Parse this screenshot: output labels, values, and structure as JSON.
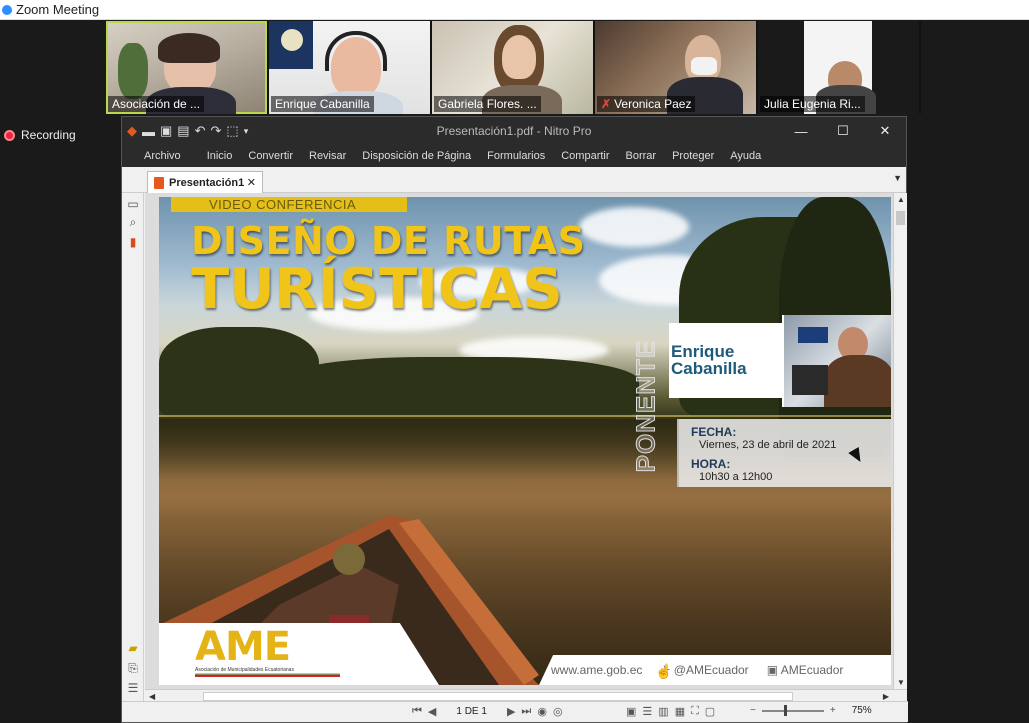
{
  "zoom": {
    "window_title": "Zoom Meeting",
    "recording_label": "Recording",
    "participants": [
      {
        "name": "Asociación de ...",
        "muted": false,
        "active": true
      },
      {
        "name": "Enrique Cabanilla",
        "muted": false,
        "active": false
      },
      {
        "name": "Gabriela Flores. ...",
        "muted": false,
        "active": false
      },
      {
        "name": "Veronica Paez",
        "muted": true,
        "active": false
      },
      {
        "name": "Julia Eugenia Ri...",
        "muted": false,
        "active": false
      }
    ]
  },
  "nitro": {
    "title": "Presentación1.pdf - Nitro Pro",
    "window_controls": {
      "minimize": "—",
      "maximize": "☐",
      "close": "✕"
    },
    "menu": [
      "Archivo",
      "Inicio",
      "Convertir",
      "Revisar",
      "Disposición de Página",
      "Formularios",
      "Compartir",
      "Borrar",
      "Proteger",
      "Ayuda"
    ],
    "tab": {
      "label": "Presentación1",
      "close": "✕"
    },
    "status": {
      "page_count": "1 DE 1",
      "zoom": "75%",
      "zoom_minus": "−",
      "zoom_plus": "+"
    }
  },
  "slide": {
    "banner": "VIDEO CONFERENCIA",
    "title_line1": "DISEÑO DE RUTAS",
    "title_line2": "TURÍSTICAS",
    "ponente": "PONENTE",
    "speaker_first": "Enrique",
    "speaker_last": "Cabanilla",
    "fecha_label": "FECHA:",
    "fecha_value": "Viernes, 23 de abril de 2021",
    "hora_label": "HORA:",
    "hora_value": "10h30 a 12h00",
    "logo_text": "AME",
    "logo_sub": "Asociación de Municipalidades Ecuatorianas",
    "website": "www.ame.gob.ec",
    "twitter": "@AMEcuador",
    "facebook": "AMEcuador"
  },
  "colors": {
    "title_yellow": "#f0c419",
    "speaker_blue": "#1e5a7a",
    "nitro_dark": "#2b2b2b",
    "active_speaker": "#b9d84b",
    "recording_red": "#e24"
  }
}
